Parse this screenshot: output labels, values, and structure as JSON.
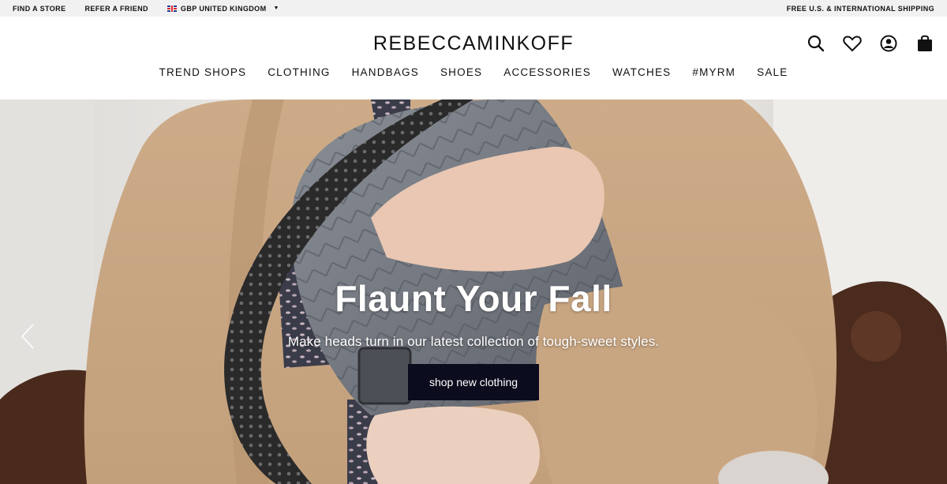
{
  "utility": {
    "find_store": "FIND A STORE",
    "refer_friend": "REFER A FRIEND",
    "country": "GBP UNITED KINGDOM",
    "shipping": "FREE U.S. & INTERNATIONAL SHIPPING"
  },
  "header": {
    "logo": "REBECCAMINKOFF",
    "icons": [
      "search-icon",
      "heart-icon",
      "account-icon",
      "shopping-bag-icon"
    ]
  },
  "nav": {
    "items": [
      "TREND SHOPS",
      "CLOTHING",
      "HANDBAGS",
      "SHOES",
      "ACCESSORIES",
      "WATCHES",
      "#MYRM",
      "SALE"
    ]
  },
  "hero": {
    "title": "Flaunt Your Fall",
    "subtitle": "Make heads turn in our latest collection of tough-sweet styles.",
    "cta": "shop new clothing"
  },
  "colors": {
    "utility_bg": "#f1f1f1",
    "cta_bg": "#0b0c1d",
    "coat": "#c9a683",
    "bag": "#6d7179"
  }
}
